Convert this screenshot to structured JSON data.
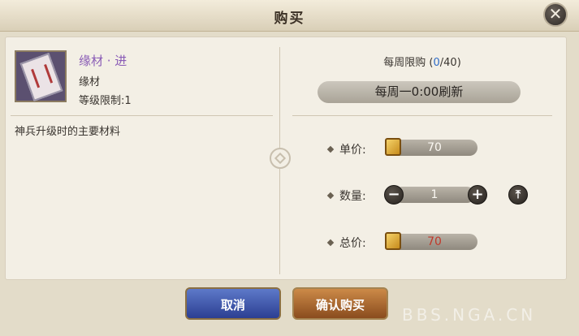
{
  "dialog": {
    "title": "购买",
    "close_icon": "close-icon"
  },
  "item": {
    "name": "缘材 · 进",
    "type": "缘材",
    "level_limit": "等级限制:1",
    "description": "神兵升级时的主要材料",
    "name_color": "#8a5cb6"
  },
  "limit": {
    "label": "每周限购",
    "open": "(",
    "bought": "0",
    "sep": "/",
    "max": "40",
    "close": ")",
    "refresh": "每周一0:00刷新"
  },
  "price": {
    "label": "单价:",
    "value": "70",
    "currency_icon": "ticket-icon"
  },
  "quantity": {
    "label": "数量:",
    "value": "1",
    "minus": "−",
    "plus": "+",
    "max": "⤒"
  },
  "total": {
    "label": "总价:",
    "value": "70",
    "color": "#c0392b"
  },
  "buttons": {
    "cancel": "取消",
    "confirm": "确认购买"
  },
  "watermark": "BBS.NGA.CN"
}
